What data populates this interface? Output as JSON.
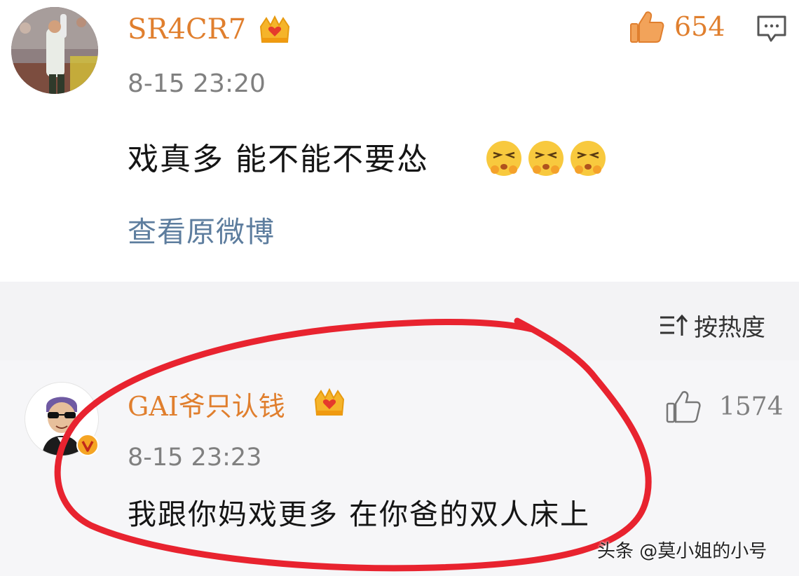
{
  "comment1": {
    "username": "SR4CR7",
    "timestamp": "8-15 23:20",
    "text": "戏真多 能不能不要怂",
    "like_count": "654",
    "view_original_label": "查看原微博"
  },
  "sort": {
    "label": "按热度"
  },
  "comment2": {
    "username": "GAI爷只认钱",
    "timestamp": "8-15 23:23",
    "text": "我跟你妈戏更多 在你爸的双人床上",
    "like_count": "1574"
  },
  "watermark": "头条 @莫小姐的小号",
  "colors": {
    "username": "#e07f2e",
    "link": "#5d7d9e",
    "annotation": "#e8232f"
  }
}
